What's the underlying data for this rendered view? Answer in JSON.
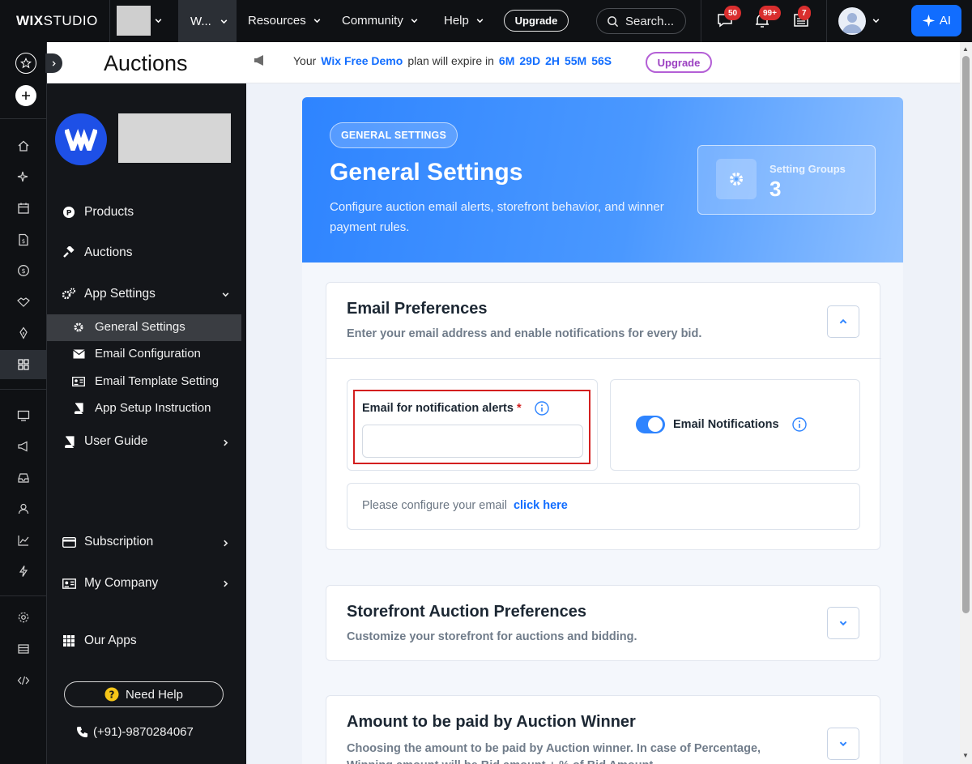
{
  "topbar": {
    "logo_bold": "WIX",
    "logo_light": "STUDIO",
    "workspace_label": "W...",
    "menus": [
      {
        "label": "Resources"
      },
      {
        "label": "Community"
      },
      {
        "label": "Help"
      }
    ],
    "upgrade_label": "Upgrade",
    "search_placeholder": "Search...",
    "badges": {
      "messages": "50",
      "notifications": "99+",
      "inbox": "7"
    },
    "ai_label": "AI"
  },
  "page": {
    "app_title": "Auctions"
  },
  "banner": {
    "prefix": "Your",
    "plan": "Wix Free Demo",
    "middle": "plan will expire in",
    "countdown": [
      "6M",
      "29D",
      "2H",
      "55M",
      "56S"
    ],
    "upgrade_label": "Upgrade"
  },
  "sidebar": {
    "items": [
      {
        "label": "Products"
      },
      {
        "label": "Auctions"
      },
      {
        "label": "App Settings"
      }
    ],
    "sub_items": [
      {
        "label": "General Settings"
      },
      {
        "label": "Email Configuration"
      },
      {
        "label": "Email Template Setting"
      },
      {
        "label": "App Setup Instruction"
      }
    ],
    "user_guide": "User Guide",
    "subscription": "Subscription",
    "my_company": "My Company",
    "our_apps": "Our Apps",
    "need_help": "Need Help",
    "phone": "(+91)-9870284067"
  },
  "hero": {
    "chip": "GENERAL SETTINGS",
    "title": "General Settings",
    "description": "Configure auction email alerts, storefront behavior, and winner payment rules.",
    "stat_label": "Setting Groups",
    "stat_value": "3"
  },
  "email_prefs": {
    "title": "Email Preferences",
    "subtitle": "Enter your email address and enable notifications for every bid.",
    "field_label": "Email for notification alerts",
    "required_mark": "*",
    "field_value": "",
    "field_placeholder": "",
    "toggle_label": "Email Notifications",
    "toggle_on": true,
    "config_text": "Please configure your email",
    "config_link": "click here"
  },
  "storefront_prefs": {
    "title": "Storefront Auction Preferences",
    "subtitle": "Customize your storefront for auctions and bidding."
  },
  "winner_amount": {
    "title": "Amount to be paid by Auction Winner",
    "subtitle": "Choosing the amount to be paid by Auction winner. In case of Percentage, Winning amount will be Bid amount + % of Bid Amount."
  },
  "colors": {
    "accent": "#116dff",
    "hero_start": "#2e84ff",
    "sidebar_bg": "#14161a",
    "badge_red": "#d92e2e",
    "upgrade_purple": "#b45fd6",
    "error_border": "#d31f1f"
  }
}
